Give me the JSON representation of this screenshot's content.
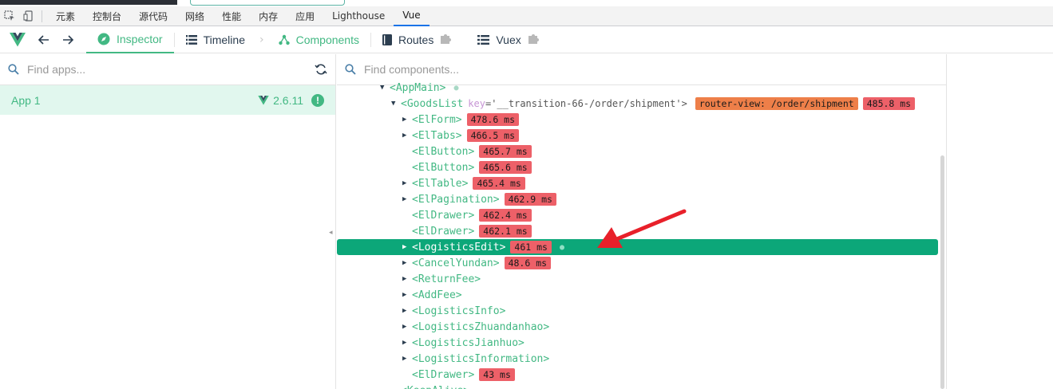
{
  "devtools": {
    "tabs": [
      "元素",
      "控制台",
      "源代码",
      "网络",
      "性能",
      "内存",
      "应用",
      "Lighthouse",
      "Vue"
    ],
    "active_tab": "Vue"
  },
  "vue_toolbar": {
    "tabs": {
      "inspector": "Inspector",
      "timeline": "Timeline",
      "components": "Components",
      "routes": "Routes",
      "vuex": "Vuex"
    }
  },
  "apps": {
    "search_placeholder": "Find apps...",
    "items": [
      {
        "name": "App 1",
        "version": "2.6.11"
      }
    ]
  },
  "components": {
    "search_placeholder": "Find components...",
    "tree": [
      {
        "name": "<AppMain>",
        "indent": 0,
        "expanded": true,
        "badges": [],
        "dot": true
      },
      {
        "name": "<GoodsList",
        "attr_key": "key",
        "attr_value": "='__transition-66-/order/shipment'>",
        "indent": 1,
        "expanded": true,
        "badges": [
          {
            "text": "router-view: /order/shipment",
            "color": "orange"
          },
          {
            "text": "485.8 ms",
            "color": "red"
          }
        ]
      },
      {
        "name": "<ElForm>",
        "indent": 2,
        "collapsed": true,
        "badges": [
          {
            "text": "478.6 ms",
            "color": "red"
          }
        ]
      },
      {
        "name": "<ElTabs>",
        "indent": 2,
        "collapsed": true,
        "badges": [
          {
            "text": "466.5 ms",
            "color": "red"
          }
        ]
      },
      {
        "name": "<ElButton>",
        "indent": 2,
        "badges": [
          {
            "text": "465.7 ms",
            "color": "red"
          }
        ]
      },
      {
        "name": "<ElButton>",
        "indent": 2,
        "badges": [
          {
            "text": "465.6 ms",
            "color": "red"
          }
        ]
      },
      {
        "name": "<ElTable>",
        "indent": 2,
        "collapsed": true,
        "badges": [
          {
            "text": "465.4 ms",
            "color": "red"
          }
        ]
      },
      {
        "name": "<ElPagination>",
        "indent": 2,
        "collapsed": true,
        "badges": [
          {
            "text": "462.9 ms",
            "color": "red"
          }
        ]
      },
      {
        "name": "<ElDrawer>",
        "indent": 2,
        "badges": [
          {
            "text": "462.4 ms",
            "color": "red"
          }
        ]
      },
      {
        "name": "<ElDrawer>",
        "indent": 2,
        "badges": [
          {
            "text": "462.1 ms",
            "color": "red"
          }
        ]
      },
      {
        "name": "<LogisticsEdit>",
        "indent": 2,
        "collapsed": true,
        "selected": true,
        "badges": [
          {
            "text": "461 ms",
            "color": "red"
          }
        ],
        "dot": true
      },
      {
        "name": "<CancelYundan>",
        "indent": 2,
        "collapsed": true,
        "badges": [
          {
            "text": "48.6 ms",
            "color": "red"
          }
        ]
      },
      {
        "name": "<ReturnFee>",
        "indent": 2,
        "collapsed": true,
        "badges": []
      },
      {
        "name": "<AddFee>",
        "indent": 2,
        "collapsed": true,
        "badges": []
      },
      {
        "name": "<LogisticsInfo>",
        "indent": 2,
        "collapsed": true,
        "badges": []
      },
      {
        "name": "<LogisticsZhuandanhao>",
        "indent": 2,
        "collapsed": true,
        "badges": []
      },
      {
        "name": "<LogisticsJianhuo>",
        "indent": 2,
        "collapsed": true,
        "badges": []
      },
      {
        "name": "<LogisticsInformation>",
        "indent": 2,
        "collapsed": true,
        "badges": []
      },
      {
        "name": "<ElDrawer>",
        "indent": 2,
        "badges": [
          {
            "text": "43 ms",
            "color": "red"
          }
        ]
      },
      {
        "name": "<KeepAlive>",
        "indent": 1,
        "badges": []
      }
    ]
  },
  "colors": {
    "vue_green": "#42b883",
    "selected_row": "#0ca779",
    "badge_red": "#ed6068",
    "badge_orange": "#ee7f49",
    "annotation_arrow": "#e8202a"
  }
}
